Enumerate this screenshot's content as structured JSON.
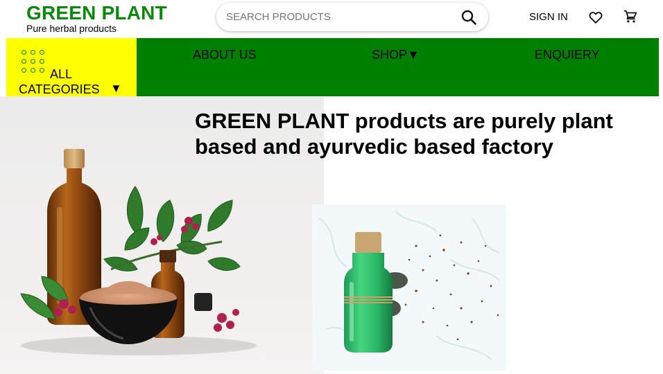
{
  "brand": {
    "name": "GREEN PLANT",
    "tagline": "Pure herbal products",
    "color": "#0a8a0a"
  },
  "search": {
    "placeholder": "SEARCH PRODUCTS",
    "value": "",
    "icon": "search-icon"
  },
  "header_actions": {
    "sign_in": "SIGN IN",
    "wishlist_icon": "heart-icon",
    "cart_icon": "cart-icon"
  },
  "nav": {
    "background": "#008000",
    "categories": {
      "label_line1": "ALL",
      "label_line2": "CATEGORIES",
      "arrow": "▼",
      "background": "#ffff00",
      "icon": "grid-icon"
    },
    "links": [
      {
        "label": "ABOUT US"
      },
      {
        "label": "SHOP▼"
      },
      {
        "label": "ENQUIERY"
      }
    ]
  },
  "hero": {
    "title": "GREEN PLANT products are purely plant based and ayurvedic based factory"
  }
}
